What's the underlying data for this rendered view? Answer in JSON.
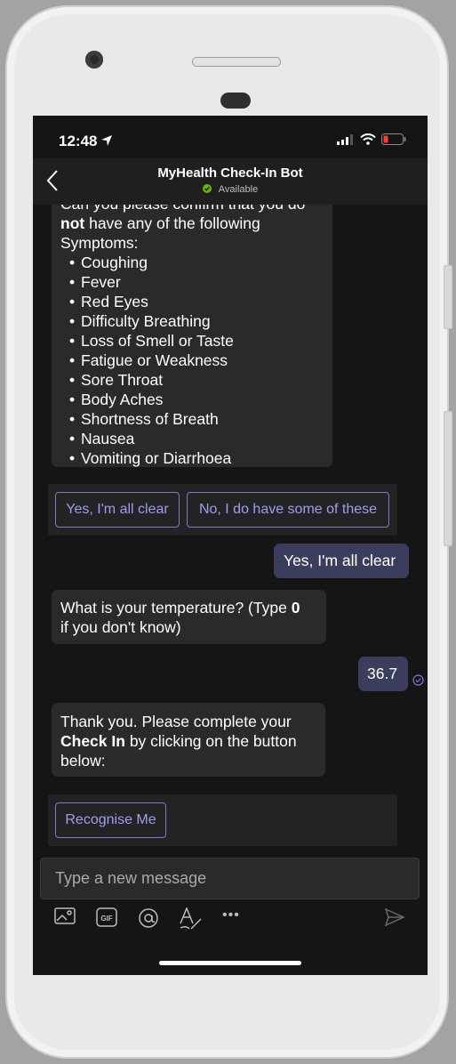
{
  "status": {
    "time": "12:48"
  },
  "header": {
    "title": "MyHealth Check-In Bot",
    "presence": "Available"
  },
  "messages": {
    "symptoms_cut": "Can you please confirm that you do",
    "symptoms_line1_bold": "not",
    "symptoms_line1_rest": " have any of the following",
    "symptoms_line2": "Symptoms:",
    "symptoms": [
      "Coughing",
      "Fever",
      "Red Eyes",
      "Difficulty Breathing",
      "Loss of Smell or Taste",
      "Fatigue or Weakness",
      "Sore Throat",
      "Body Aches",
      "Shortness of Breath",
      "Nausea",
      "Vomiting or Diarrhoea"
    ],
    "btn_yes": "Yes, I'm all clear",
    "btn_no": "No, I do have some of these",
    "reply_yes": "Yes, I'm all clear",
    "temp_q_pre": "What is your temperature? (Type ",
    "temp_q_bold": "0",
    "temp_q_post": "if you don't know)",
    "reply_temp": "36.7",
    "thanks_line1": "Thank you. Please complete your",
    "thanks_bold": "Check In",
    "thanks_rest": " by clicking on the button",
    "thanks_line3": "below:",
    "btn_recognise": "Recognise Me"
  },
  "compose": {
    "placeholder": "Type a new message"
  },
  "toolbar": {
    "more": "•••"
  },
  "colors": {
    "accent": "#7b7cd1",
    "outgoing_bubble": "#3b3d5c",
    "incoming_bubble": "#2a2a2a",
    "background": "#151515"
  }
}
